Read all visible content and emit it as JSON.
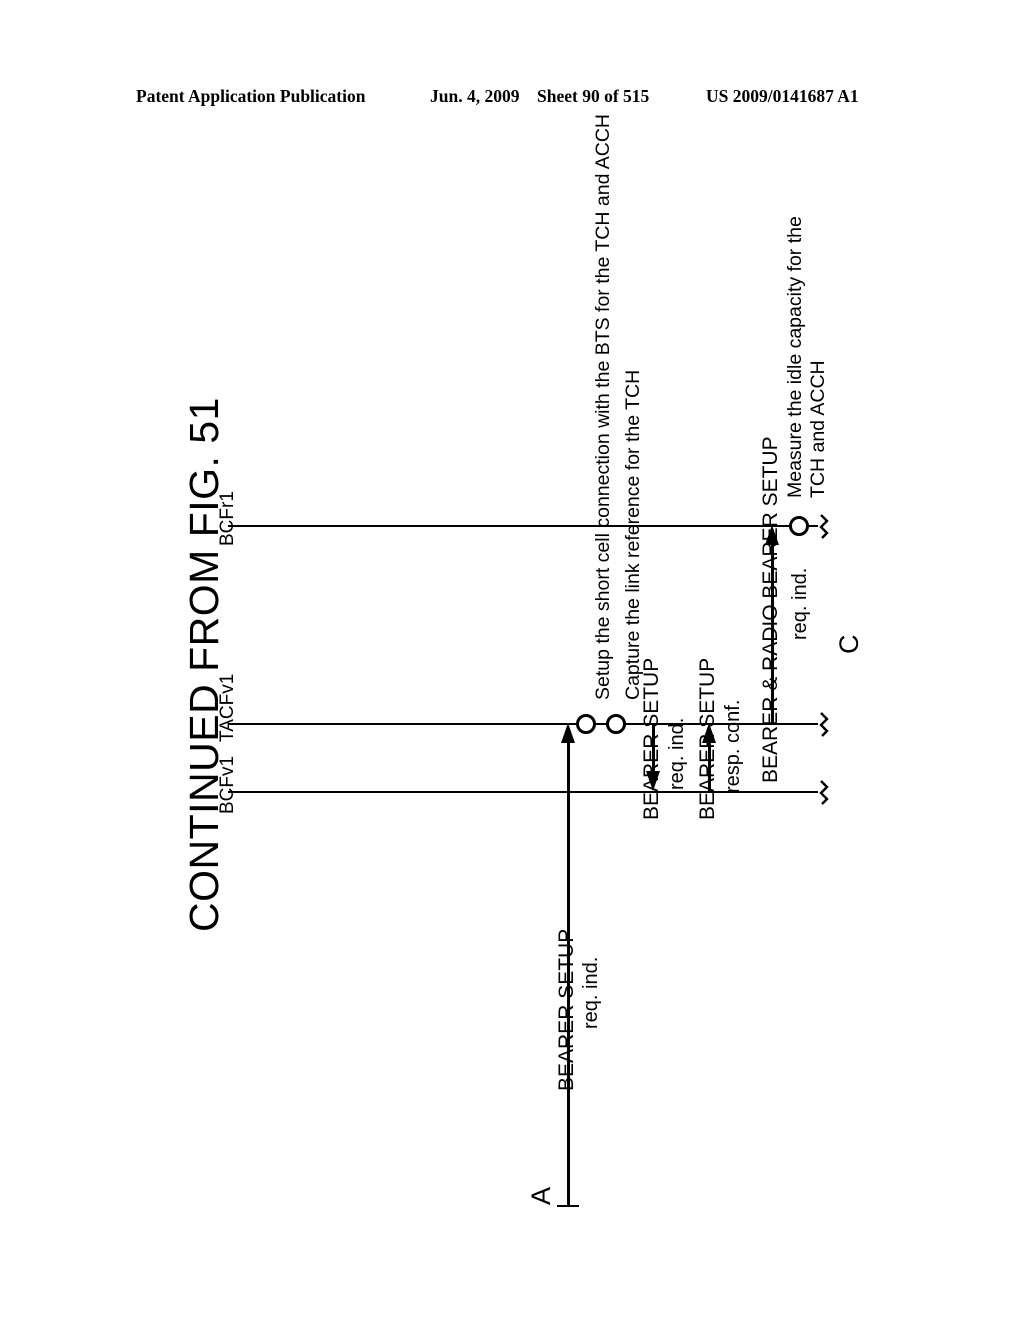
{
  "header": {
    "publication": "Patent Application Publication",
    "date": "Jun. 4, 2009",
    "sheet": "Sheet 90 of 515",
    "patent_number": "US 2009/0141687 A1"
  },
  "figure": {
    "title": "CONTINUED FROM FIG. 51",
    "lifelines": [
      {
        "name": "BCFv1"
      },
      {
        "name": "TACFv1"
      },
      {
        "name": "BCFr1"
      }
    ],
    "annotations": [
      {
        "text": "Setup the short cell connection with the BTS for the TCH and ACCH"
      },
      {
        "text": "Capture the link reference for the TCH"
      },
      {
        "text": "Measure the idle capacity for the"
      },
      {
        "text": "TCH and ACCH"
      }
    ],
    "messages": [
      {
        "name": "BEARER SETUP",
        "sub": "req. ind."
      },
      {
        "name": "BEARER SETUP",
        "sub": "req. ind."
      },
      {
        "name": "BEARER SETUP",
        "sub": "resp. conf."
      },
      {
        "name": "BEARER & RADIO BEARER SETUP",
        "sub": "req. ind."
      }
    ],
    "connectors": [
      {
        "label": "A"
      },
      {
        "label": "C"
      }
    ],
    "colors": {
      "ink": "#000000",
      "paper": "#ffffff"
    }
  }
}
